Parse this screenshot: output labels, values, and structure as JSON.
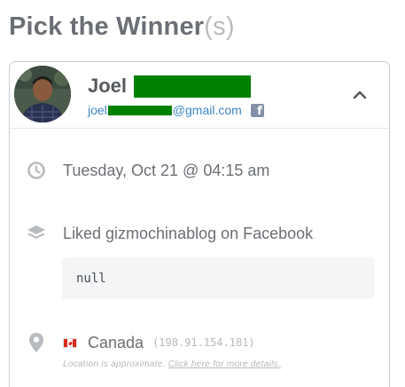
{
  "heading": {
    "title": "Pick the Winner",
    "suffix": "(s)"
  },
  "winner": {
    "name": "Joel",
    "email_prefix": "joel",
    "email_suffix": "@gmail.com",
    "email_source_icon": "facebook-icon",
    "collapse_icon": "chevron-up-icon"
  },
  "entry": {
    "timestamp": "Tuesday, Oct 21 @ 04:15 am",
    "timestamp_icon": "clock-icon",
    "action": "Liked gizmochinablog on Facebook",
    "action_icon": "layers-icon",
    "action_value": "null",
    "location_icon": "map-pin-icon",
    "country": "Canada",
    "country_flag": "canada-flag",
    "ip": "(198.91.154.181)",
    "location_note": "Location is approximate.",
    "location_link": "Click here for more details."
  },
  "colors": {
    "heading": "#6b6f75",
    "heading_suffix": "#b9bcc0",
    "email_link": "#3b86c6",
    "redaction": "#008000",
    "icon_gray": "#b8bbbf",
    "card_border": "#c9ccd0"
  }
}
